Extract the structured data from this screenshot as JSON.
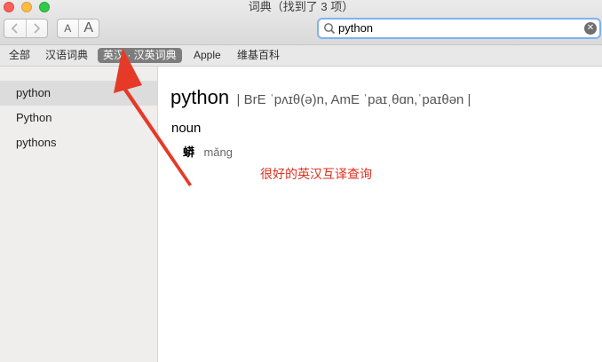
{
  "window": {
    "title": "词典（找到了 3 项）"
  },
  "toolbar": {
    "back_icon": "chevron-left-icon",
    "forward_icon": "chevron-right-icon",
    "font_smaller_label": "A",
    "font_larger_label": "A"
  },
  "search": {
    "value": "python",
    "icon": "search-icon",
    "clear_icon": "clear-icon"
  },
  "scopes": [
    {
      "label": "全部"
    },
    {
      "label": "汉语词典"
    },
    {
      "label": "英汉 · 汉英词典",
      "selected": true
    },
    {
      "label": "Apple"
    },
    {
      "label": "维基百科"
    }
  ],
  "sidebar": {
    "items": [
      {
        "label": "python",
        "selected": true
      },
      {
        "label": "Python"
      },
      {
        "label": "pythons"
      }
    ]
  },
  "entry": {
    "headword": "python",
    "pronunciation": "| BrE ˈpʌɪθ(ə)n,  AmE ˈpaɪˌθɑn,ˈpaɪθən |",
    "part_of_speech": "noun",
    "sense_zh": "蟒",
    "sense_pinyin": "mǎng"
  },
  "annotation": {
    "text": "很好的英汉互译查询",
    "color": "#e0301e"
  }
}
